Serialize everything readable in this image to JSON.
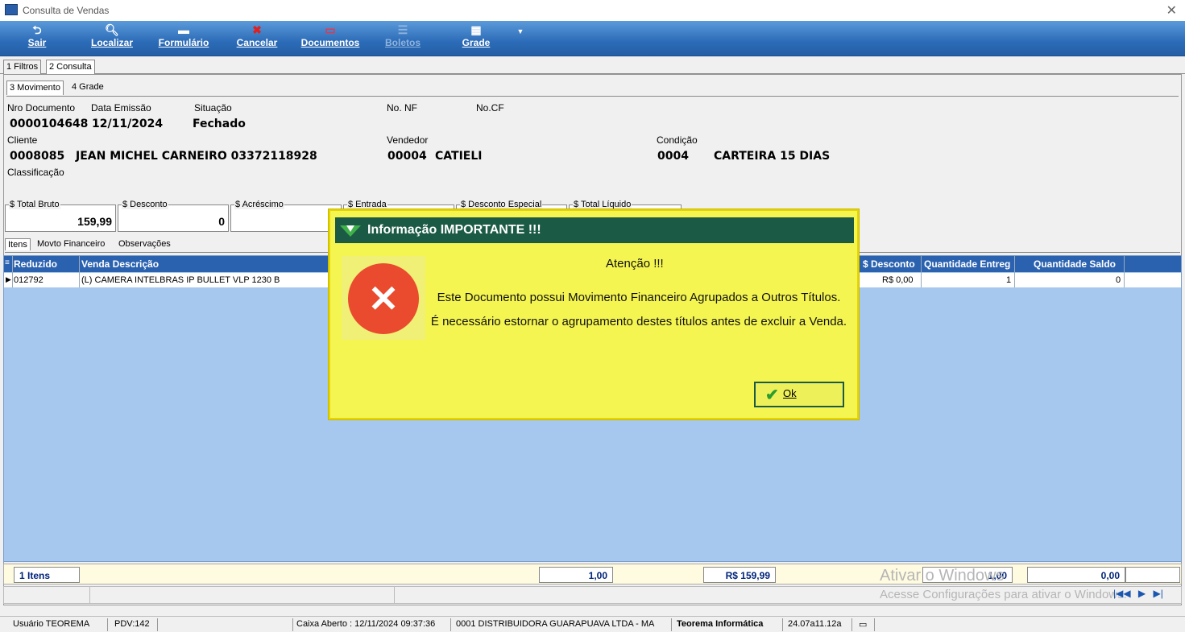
{
  "window": {
    "title": "Consulta de Vendas"
  },
  "toolbar": {
    "sair": "Sair",
    "localizar": "Localizar",
    "formulario": "Formulário",
    "cancelar": "Cancelar",
    "documentos": "Documentos",
    "boletos": "Boletos",
    "grade": "Grade"
  },
  "tabs_top": [
    "1 Filtros",
    "2 Consulta"
  ],
  "tabs_sub": [
    "3 Movimento",
    "4 Grade"
  ],
  "header": {
    "nro_documento_label": "Nro Documento",
    "nro_documento": "0000104648",
    "data_emissao_label": "Data Emissão",
    "data_emissao": "12/11/2024",
    "situacao_label": "Situação",
    "situacao": "Fechado",
    "no_nf_label": "No. NF",
    "no_cf_label": "No.CF",
    "cliente_label": "Cliente",
    "cliente_codigo": "0008085",
    "cliente_nome": "JEAN MICHEL CARNEIRO 03372118928",
    "vendedor_label": "Vendedor",
    "vendedor_codigo": "00004",
    "vendedor_nome": "CATIELI",
    "condicao_label": "Condição",
    "condicao_codigo": "0004",
    "condicao_nome": "CARTEIRA 15 DIAS",
    "classificacao_label": "Classificação"
  },
  "totals": {
    "total_bruto_label": "$ Total Bruto",
    "total_bruto": "159,99",
    "desconto_label": "$ Desconto",
    "desconto": "0",
    "acrescimo_label": "$ Acréscimo",
    "entrada_label": "$ Entrada",
    "desconto_especial_label": "$ Desconto Especial",
    "total_liquido_label": "$ Total Líquido"
  },
  "grid_tabs": [
    "Itens",
    "Movto Financeiro",
    "Observações"
  ],
  "grid": {
    "columns": {
      "reduzido": "Reduzido",
      "venda_descricao": "Venda Descrição",
      "desconto": "$ Desconto",
      "qtd_entregue": "Quantidade Entreg",
      "qtd_saldo": "Quantidade Saldo"
    },
    "row": {
      "reduzido": "012792",
      "descricao": "(L) CAMERA INTELBRAS IP BULLET VLP 1230 B",
      "desconto": "R$ 0,00",
      "qtd_entregue": "1",
      "qtd_saldo": "0"
    }
  },
  "footer": {
    "itens": "1 Itens",
    "qtd": "1,00",
    "valor": "R$ 159,99",
    "qtd_entregue": "1,00",
    "qtd_saldo": "0,00"
  },
  "watermark": {
    "line1": "Ativar o Windows",
    "line2": "Acesse Configurações para ativar o Windows."
  },
  "statusbar": {
    "usuario": "Usuário TEOREMA",
    "pdv": "PDV:142",
    "caixa": "Caixa Aberto : 12/11/2024 09:37:36",
    "empresa": "0001 DISTRIBUIDORA GUARAPUAVA LTDA - MA",
    "sistema": "Teorema Informática",
    "versao": "24.07a11.12a"
  },
  "dialog": {
    "title": "Informação IMPORTANTE !!!",
    "heading": "Atenção !!!",
    "message_line1": "Este Documento possui Movimento Financeiro Agrupados a Outros Títulos.",
    "message_line2": "É necessário estornar o agrupamento destes títulos antes de excluir a Venda.",
    "ok_label": "Ok"
  },
  "colors": {
    "toolbar": "#2c6cb8",
    "dialog_bg": "#f5f551",
    "dialog_header": "#1b5a44",
    "error": "#ea4a2e",
    "grid_header": "#2b62b0"
  }
}
